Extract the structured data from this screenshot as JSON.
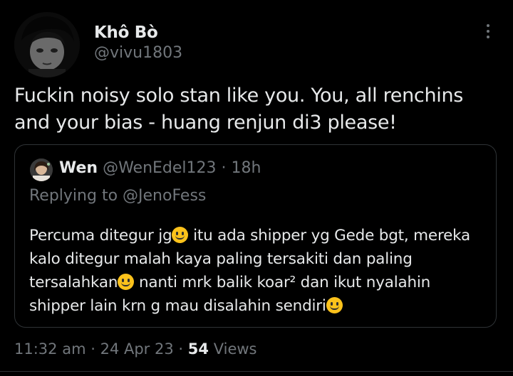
{
  "tweet": {
    "author_name": "Khô Bò",
    "author_handle": "@vivu1803",
    "text": "Fuckin noisy solo stan like you. You, all renchins and your bias - huang renjun di3 please!",
    "time": "11:32 am",
    "date": "24 Apr 23",
    "sep": "·",
    "views_count": "54",
    "views_label": "Views"
  },
  "quote": {
    "author_name": "Wen",
    "author_handle": "@WenEdel123",
    "sep": "·",
    "time": "18h",
    "replying_prefix": "Replying to",
    "replying_handle": "@JenoFess",
    "text_parts": [
      "Percuma ditegur jg",
      " itu ada shipper  yg Gede bgt, mereka kalo ditegur malah kaya paling tersakiti dan paling tersalahkan",
      " nanti mrk balik koar² dan ikut nyalahin shipper lain krn g mau disalahin sendiri"
    ]
  },
  "icons": {
    "more": "more-vertical-icon",
    "emoji": "slightly-smiling-face-emoji"
  },
  "colors": {
    "background": "#000000",
    "text": "#e7e9ea",
    "secondary": "#71767b",
    "border": "#2f3336"
  }
}
